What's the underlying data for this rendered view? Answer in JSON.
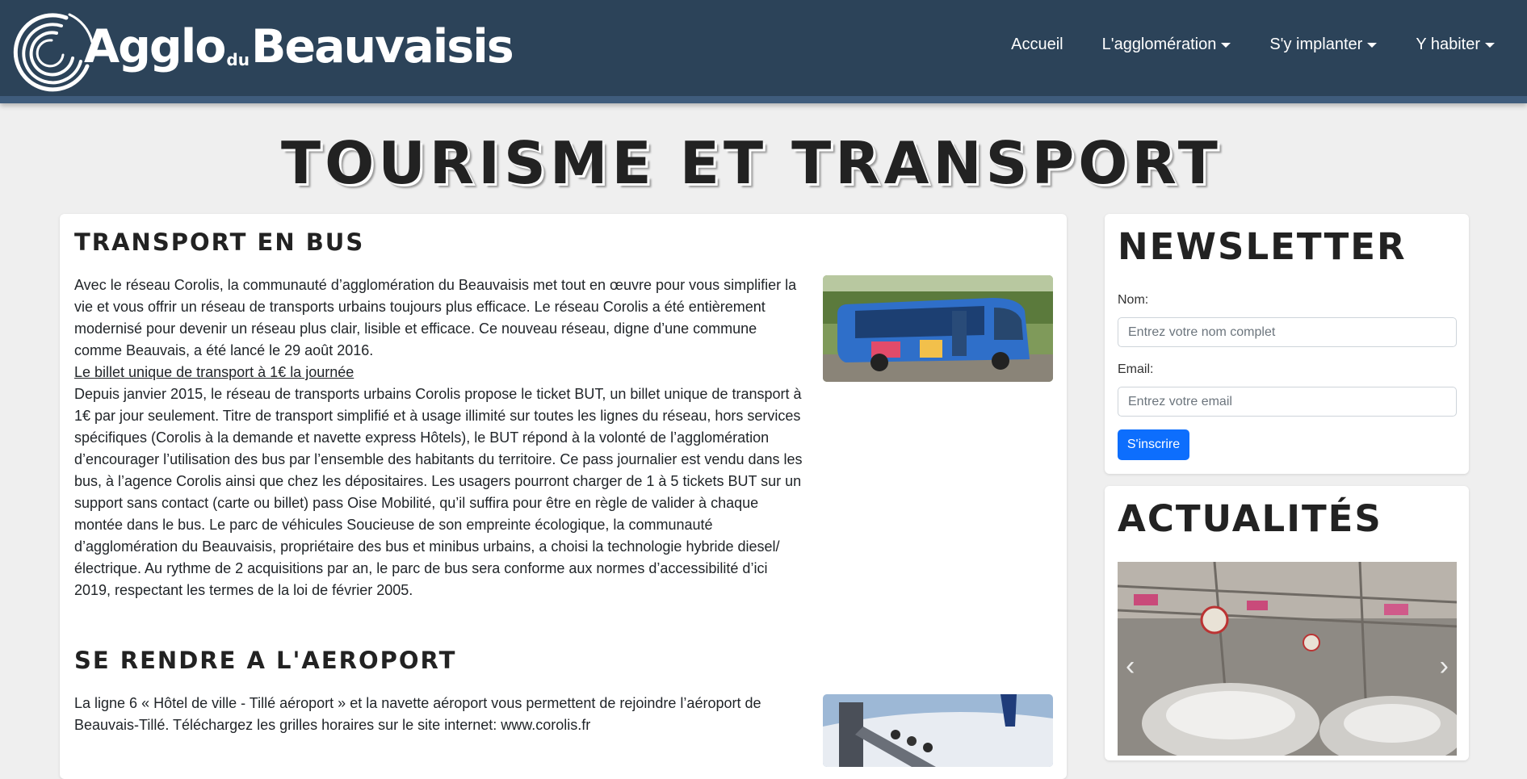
{
  "header": {
    "logo_main": "Agglo",
    "logo_du": "du",
    "logo_name": "Beauvaisis",
    "nav": [
      {
        "label": "Accueil",
        "dropdown": false
      },
      {
        "label": "L'agglomération",
        "dropdown": true
      },
      {
        "label": "S'y implanter",
        "dropdown": true
      },
      {
        "label": "Y habiter",
        "dropdown": true
      }
    ]
  },
  "page": {
    "title": "TOURISME ET TRANSPORT"
  },
  "sections": {
    "bus": {
      "title": "TRANSPORT EN BUS",
      "intro": "Avec le réseau Corolis, la communauté d’agglomération du Beauvaisis met tout en œuvre pour vous simplifier la vie et vous offrir un réseau de transports urbains toujours plus efficace. Le réseau Corolis a été entièrement modernisé pour devenir un réseau plus clair, lisible et efficace. Ce nouveau réseau, digne d’une commune comme Beauvais, a été lancé le 29 août 2016.",
      "link": "Le billet unique de transport à 1€ la journée",
      "body": "Depuis janvier 2015, le réseau de transports urbains Corolis propose le ticket BUT, un billet unique de transport à 1€ par jour seulement. Titre de transport simplifié et à usage illimité sur toutes les lignes du réseau, hors services spécifiques (Corolis à la demande et navette express Hôtels), le BUT répond à la volonté de l’agglomération d’encourager l’utilisation des bus par l’ensemble des habitants du territoire. Ce pass journalier est vendu dans les bus, à l’agence Corolis ainsi que chez les dépositaires. Les usagers pourront charger de 1 à 5 tickets BUT sur un support sans contact (carte ou billet) pass Oise Mobilité, qu’il suffira pour être en règle de valider à chaque montée dans le bus. Le parc de véhicules Soucieuse de son empreinte écologique, la communauté d’agglomération du Beauvaisis, propriétaire des bus et minibus urbains, a choisi la technologie hybride diesel/électrique. Au rythme de 2 acquisitions par an, le parc de bus sera conforme aux normes d’accessibilité d’ici 2019, respectant les termes de la loi de février 2005."
    },
    "airport": {
      "title": "SE RENDRE A L'AEROPORT",
      "body": "La ligne 6 « Hôtel de ville - Tillé aéroport » et la navette aéroport vous permettent de rejoindre l’aéroport de Beauvais-Tillé. Téléchargez les grilles horaires sur le site internet: www.corolis.fr"
    }
  },
  "sidebar": {
    "newsletter": {
      "title": "NEWSLETTER",
      "name_label": "Nom:",
      "name_placeholder": "Entrez votre nom complet",
      "email_label": "Email:",
      "email_placeholder": "Entrez votre email",
      "submit_label": "S'inscrire"
    },
    "news": {
      "title": "ACTUALITÉS",
      "prev_icon": "chevron-left-icon",
      "next_icon": "chevron-right-icon"
    }
  },
  "colors": {
    "navbar": "#2c4359",
    "navbar_border": "#3f5c7c",
    "background": "#efefef",
    "primary_button": "#0d6efd"
  }
}
